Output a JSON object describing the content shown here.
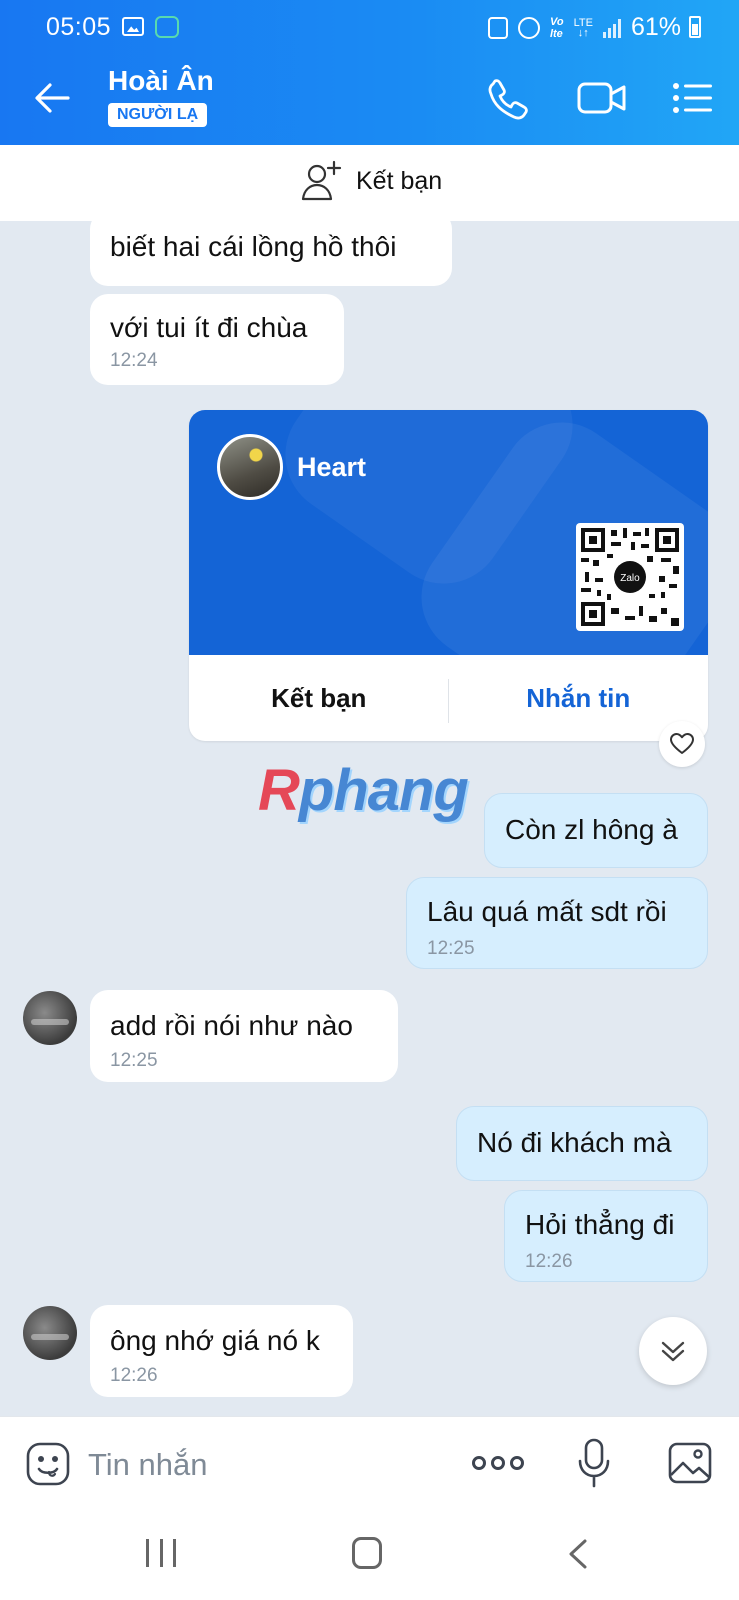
{
  "status_bar": {
    "time": "05:05",
    "battery": "61%"
  },
  "header": {
    "title": "Hoài Ân",
    "badge": "NGƯỜI LẠ"
  },
  "add_friend_bar": {
    "label": "Kết bạn"
  },
  "messages": [
    {
      "id": "m1",
      "direction": "in",
      "text": "biết hai cái lồng hồ thôi",
      "time": ""
    },
    {
      "id": "m2",
      "direction": "in",
      "text": "với tui ít đi chùa",
      "time": "12:24"
    },
    {
      "id": "m3",
      "direction": "out",
      "text": "Còn zl hông à",
      "time": ""
    },
    {
      "id": "m4",
      "direction": "out",
      "text": "Lâu quá mất sdt rồi",
      "time": "12:25"
    },
    {
      "id": "m5",
      "direction": "in",
      "text": "add rồi nói như nào",
      "time": "12:25"
    },
    {
      "id": "m6",
      "direction": "out",
      "text": "Nó đi khách mà",
      "time": ""
    },
    {
      "id": "m7",
      "direction": "out",
      "text": "Hỏi thẳng đi",
      "time": "12:26"
    },
    {
      "id": "m8",
      "direction": "in",
      "text": "ông nhớ giá nó k",
      "time": "12:26"
    }
  ],
  "contact_card": {
    "name": "Heart",
    "qr_logo_text": "Zalo",
    "add_friend_label": "Kết bạn",
    "message_label": "Nhắn tin"
  },
  "watermark": {
    "first_letter": "R",
    "rest": "phang"
  },
  "input": {
    "placeholder": "Tin nhắn"
  },
  "colors": {
    "header_gradient_start": "#1877f2",
    "header_gradient_end": "#21a6f6",
    "card_blue": "#1464d6",
    "outgoing_bubble": "#d6eefe",
    "chat_background": "#e2e9f1"
  }
}
